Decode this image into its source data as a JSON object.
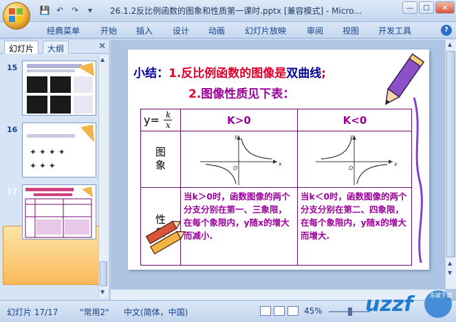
{
  "window": {
    "title": "26.1.2反比例函数的图象和性质第一课时.pptx [兼容模式] - Micro...",
    "minimize": "—",
    "maximize": "☐",
    "close": "✕"
  },
  "qat": {
    "save": "💾",
    "undo": "↶",
    "redo": "↷"
  },
  "ribbon": {
    "tabs": [
      "经典菜单",
      "开始",
      "插入",
      "设计",
      "动画",
      "幻灯片放映",
      "审阅",
      "视图",
      "开发工具"
    ],
    "help": "?"
  },
  "pane": {
    "tabs": [
      "幻灯片",
      "大纲"
    ],
    "close": "✕",
    "slides": [
      {
        "number": "15"
      },
      {
        "number": "16"
      },
      {
        "number": "17"
      }
    ]
  },
  "slide": {
    "heading_prefix": "小结：",
    "line1_num": "1.",
    "line1_a": "反比例函数的图像是",
    "line1_b": "双曲线",
    "line1_c": ";",
    "line2_num": "2.",
    "line2_text": "图像性质见下表：",
    "table": {
      "y_label": "y=",
      "frac_num": "k",
      "frac_den": "x",
      "col1": "K>0",
      "col2": "K<0",
      "row1": "图象",
      "row2": "性质",
      "graph_axis_x": "x",
      "graph_axis_y": "y",
      "graph_origin": "O",
      "prop1": "当k＞0时，函数图像的两个分支分别在第一、三象限，在每个象限内，y随x的增大而减小.",
      "prop2": "当k＜0时，函数图像的两个分支分别在第二、四象限，在每个象限内，y随x的增大而增大."
    }
  },
  "status": {
    "slide_info": "幻灯片 17/17",
    "theme": "\"常用2\"",
    "language": "中文(简体，中国)",
    "zoom": "45%"
  },
  "watermark": {
    "text": "uzzf",
    "sub": "东坡下载"
  },
  "colors": {
    "accent": "#9b009b",
    "heading": "#00009c",
    "red": "#e0002b"
  }
}
